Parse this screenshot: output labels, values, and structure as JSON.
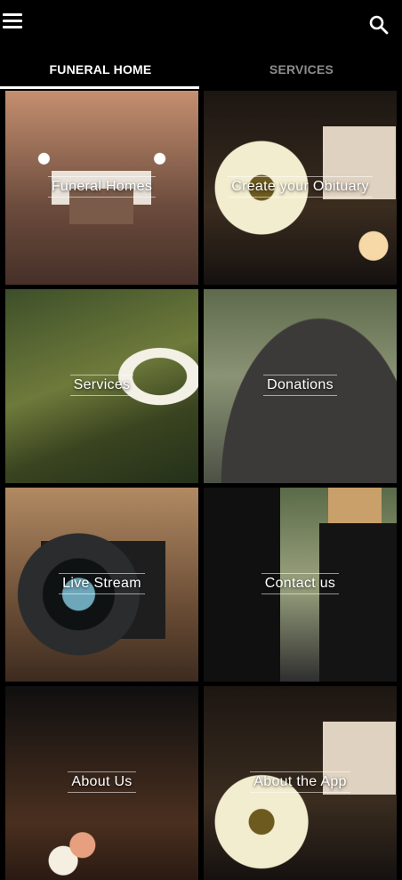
{
  "app": {
    "menu_icon": "hamburger-menu-icon",
    "search_icon": "search-icon"
  },
  "tabs": [
    {
      "label": "FUNERAL HOME",
      "active": true
    },
    {
      "label": "SERVICES",
      "active": false
    }
  ],
  "tiles": [
    {
      "label": "Funeral Homes"
    },
    {
      "label": "Create your Obituary"
    },
    {
      "label": "Services"
    },
    {
      "label": "Donations"
    },
    {
      "label": "Live Stream"
    },
    {
      "label": "Contact us"
    },
    {
      "label": "About Us"
    },
    {
      "label": "About the App"
    }
  ],
  "colors": {
    "background": "#000000",
    "tab_active": "#ffffff",
    "tab_inactive": "#8c8c8c"
  }
}
